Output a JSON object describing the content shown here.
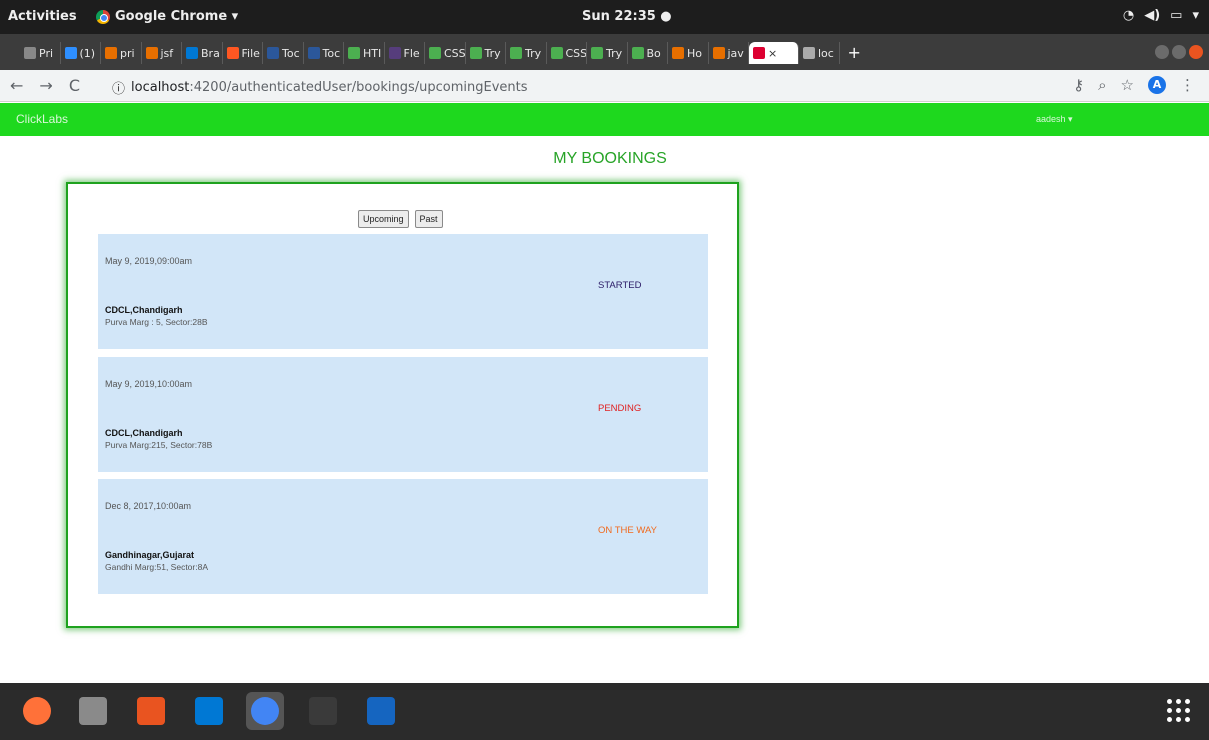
{
  "system_bar": {
    "activities": "Activities",
    "app_name": "Google Chrome ▾",
    "clock": "Sun 22:35 ●",
    "tray_icons": [
      "wifi-icon",
      "volume-icon",
      "battery-icon",
      "menu-caret-icon"
    ]
  },
  "tabs": [
    {
      "label": "Pri",
      "icon": "doc-icon",
      "color": "#888888"
    },
    {
      "label": "(1)",
      "icon": "chat-icon",
      "color": "#2e8fff"
    },
    {
      "label": "pri",
      "icon": "java-icon",
      "color": "#e76f00"
    },
    {
      "label": "jsf",
      "icon": "java-icon",
      "color": "#e76f00"
    },
    {
      "label": "Bra",
      "icon": "azure-icon",
      "color": "#0078d4"
    },
    {
      "label": "File",
      "icon": "heart-icon",
      "color": "#ff5722"
    },
    {
      "label": "Toc",
      "icon": "terminal-icon",
      "color": "#2b579a"
    },
    {
      "label": "Toc",
      "icon": "terminal-icon",
      "color": "#2b579a"
    },
    {
      "label": "HTI",
      "icon": "w3-icon",
      "color": "#4caf50"
    },
    {
      "label": "Fle",
      "icon": "bootstrap-icon",
      "color": "#563d7c"
    },
    {
      "label": "CSS",
      "icon": "w3-icon",
      "color": "#4caf50"
    },
    {
      "label": "Try",
      "icon": "w3-icon",
      "color": "#4caf50"
    },
    {
      "label": "Try",
      "icon": "w3-icon",
      "color": "#4caf50"
    },
    {
      "label": "CSS",
      "icon": "w3-icon",
      "color": "#4caf50"
    },
    {
      "label": "Try",
      "icon": "w3-icon",
      "color": "#4caf50"
    },
    {
      "label": "Bo",
      "icon": "w3-icon",
      "color": "#4caf50"
    },
    {
      "label": "Ho",
      "icon": "java-icon",
      "color": "#e76f00"
    },
    {
      "label": "jav",
      "icon": "java-icon",
      "color": "#e76f00"
    },
    {
      "label": "×",
      "icon": "angular-icon",
      "color": "#dd0031",
      "active": true
    },
    {
      "label": "loc",
      "icon": "page-icon",
      "color": "#aaaaaa"
    }
  ],
  "toolbar": {
    "url_host": "localhost",
    "url_path": ":4200/authenticatedUser/bookings/upcomingEvents",
    "avatar_letter": "A"
  },
  "app": {
    "brand": "ClickLabs",
    "user": "aadesh ▾",
    "accent_color": "#1ed81e"
  },
  "page": {
    "title": "MY BOOKINGS",
    "tab_upcoming": "Upcoming",
    "tab_past": "Past"
  },
  "bookings": [
    {
      "date": "May 9, 2019,09:00am",
      "name": "CDCL,Chandigarh",
      "address": "Purva Marg : 5, Sector:28B",
      "status": "STARTED",
      "status_color": "#2a1a66"
    },
    {
      "date": "May 9, 2019,10:00am",
      "name": "CDCL,Chandigarh",
      "address": "Purva Marg:215, Sector:78B",
      "status": "PENDING",
      "status_color": "#e02020"
    },
    {
      "date": "Dec 8, 2017,10:00am",
      "name": "Gandhinagar,Gujarat",
      "address": "Gandhi Marg:51, Sector:8A",
      "status": "ON THE WAY",
      "status_color": "#f06a1e"
    }
  ],
  "dock": [
    {
      "icon": "firefox-icon",
      "color": "#ff7139"
    },
    {
      "icon": "files-icon",
      "color": "#8a8a8a"
    },
    {
      "icon": "software-center-icon",
      "color": "#e95420"
    },
    {
      "icon": "vscode-icon",
      "color": "#0078d4"
    },
    {
      "icon": "chrome-icon",
      "color": "#4285f4"
    },
    {
      "icon": "terminal-icon",
      "color": "#3a3a3a"
    },
    {
      "icon": "text-editor-icon",
      "color": "#1565c0"
    }
  ]
}
